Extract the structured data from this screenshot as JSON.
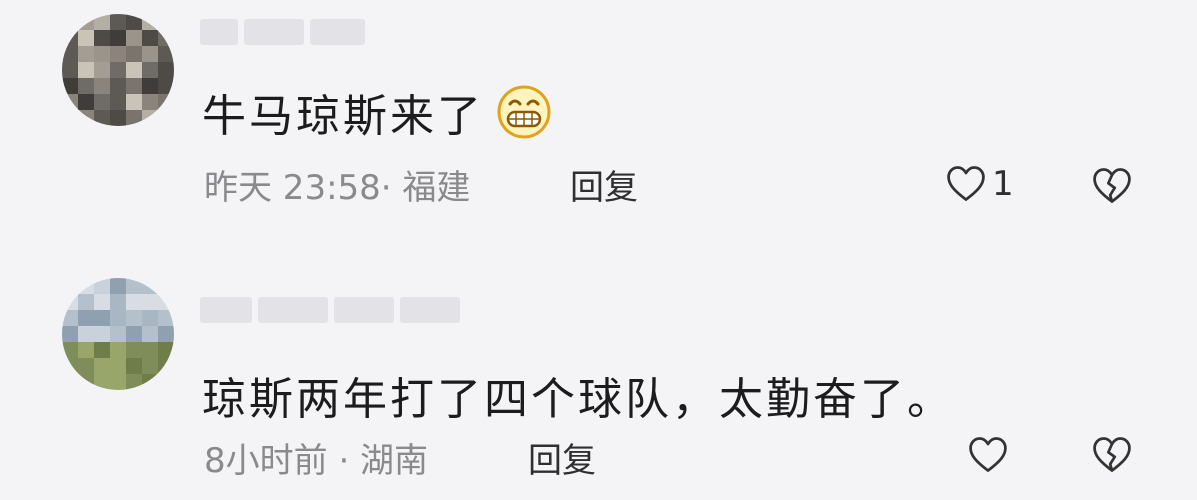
{
  "comments": [
    {
      "text": "牛马琼斯来了",
      "emoji": "grinning-face-emoji",
      "meta": "昨天 23:58· 福建",
      "reply_label": "回复",
      "like_count": "1"
    },
    {
      "text": "琼斯两年打了四个球队，太勤奋了。",
      "meta": "8小时前 · 湖南",
      "reply_label": "回复",
      "like_count": ""
    }
  ],
  "colors": {
    "background": "#f4f4f6",
    "text": "#1c1c1e",
    "meta": "#8a8a8e",
    "icon": "#333333"
  }
}
